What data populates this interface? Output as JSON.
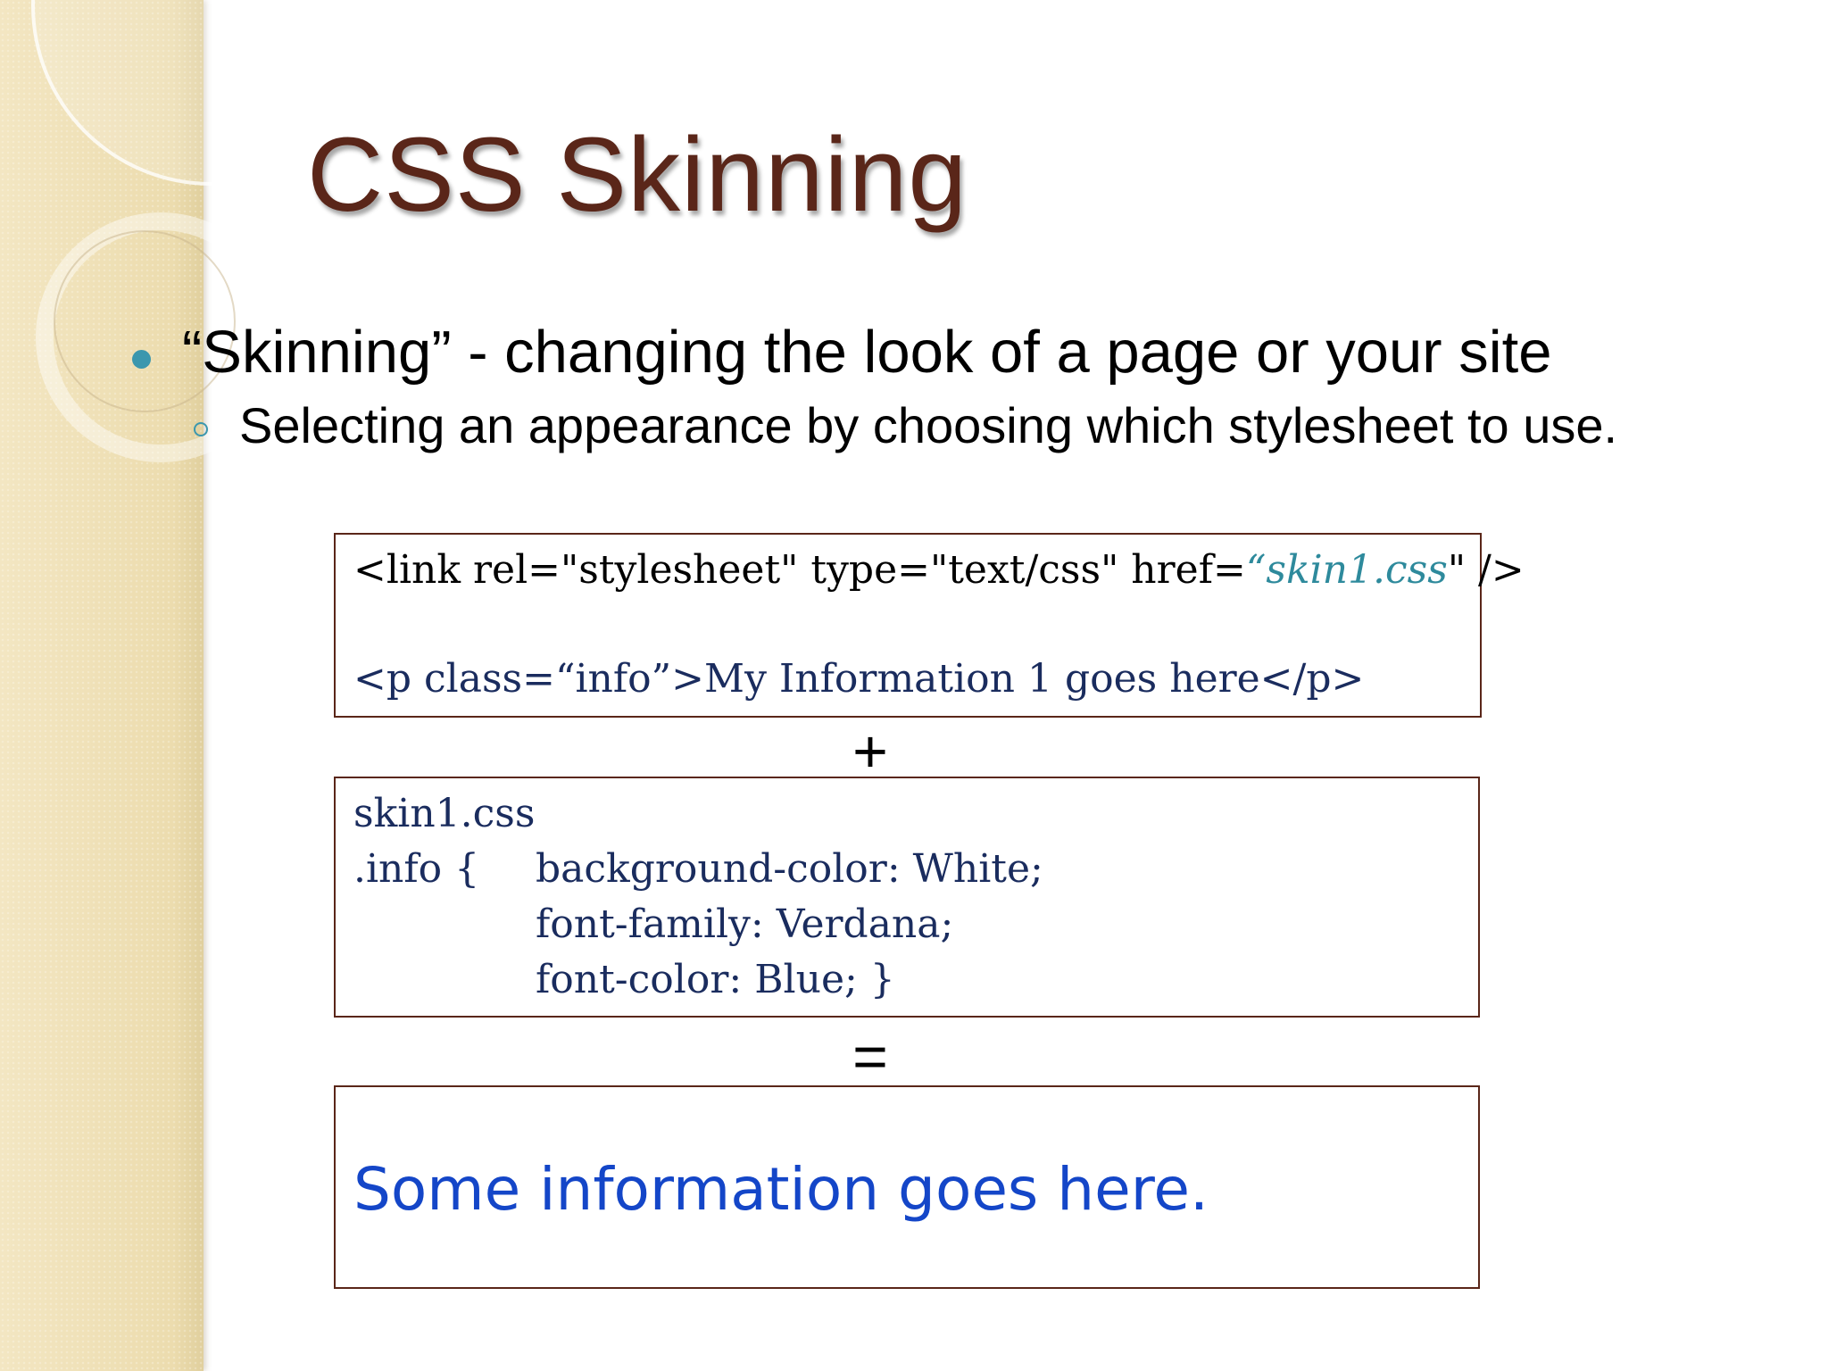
{
  "slide": {
    "title": "CSS Skinning",
    "bullet1": "“Skinning” - changing the look of a page or your site",
    "bullet2": "Selecting an appearance by choosing which stylesheet to use."
  },
  "html_box": {
    "line1_prefix": "<link rel=\"stylesheet\" type=\"text/css\" href=",
    "line1_href": "“skin1.css",
    "line1_suffix": "\" />",
    "line2": "<p class=“info”>My Information 1 goes here</p>"
  },
  "plus_symbol": "+",
  "css_box": {
    "filename": "skin1.css",
    "selector": ".info {",
    "properties": [
      "background-color: White;",
      "font-family: Verdana;",
      "font-color: Blue; }"
    ]
  },
  "equals_symbol": "=",
  "result_box": {
    "text": "Some information goes here."
  },
  "colors": {
    "title": "#5a2619",
    "accent": "#3b97ae",
    "result_text": "#1446c8",
    "code_text": "#1a2c5e",
    "box_border": "#5a2619"
  }
}
